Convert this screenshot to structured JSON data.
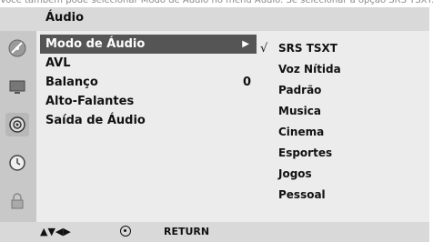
{
  "caption": "Você também pode selecionar Modo de Áudio no menu Áudio. Se selecionar a opção SRS TSXT...",
  "menu": {
    "title": "Áudio",
    "items": [
      {
        "label": "Modo de Áudio",
        "selected": true
      },
      {
        "label": "AVL"
      },
      {
        "label": "Balanço",
        "value": "0"
      },
      {
        "label": "Alto-Falantes"
      },
      {
        "label": "Saída de Áudio"
      }
    ]
  },
  "submenu": {
    "check_mark": "√",
    "items": [
      "SRS TSXT",
      "Voz Nítida",
      "Padrão",
      "Musica",
      "Cinema",
      "Esportes",
      "Jogos",
      "Pessoal"
    ]
  },
  "footer": {
    "nav_arrows": "▲▼◀▶",
    "return_label": "RETURN"
  },
  "icons": [
    "satellite-dish-icon",
    "tv-screen-icon",
    "speaker-icon",
    "clock-icon",
    "lock-icon"
  ],
  "colors": {
    "highlight": "#555555",
    "panel": "#ececec",
    "bar": "#d9d9d9"
  }
}
